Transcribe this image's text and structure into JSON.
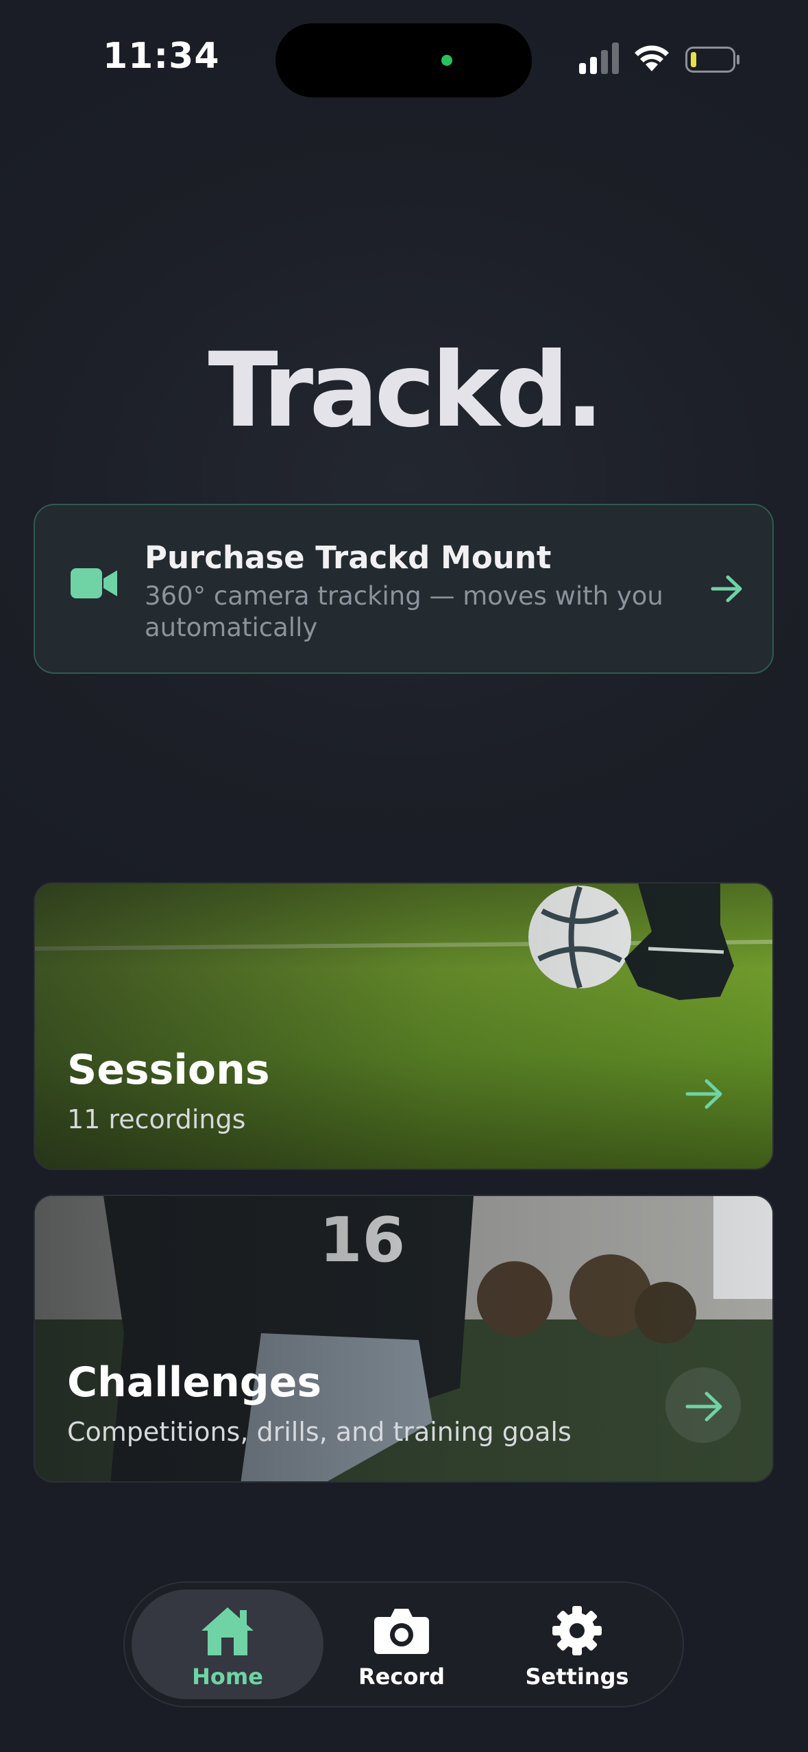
{
  "status_bar": {
    "time": "11:34"
  },
  "app": {
    "logo_text": "Trackd."
  },
  "purchase": {
    "title": "Purchase Trackd Mount",
    "subtitle": "360° camera tracking — moves with you automatically"
  },
  "cards": [
    {
      "title": "Sessions",
      "subtitle": "11 recordings"
    },
    {
      "title": "Challenges",
      "subtitle": "Competitions, drills, and training goals"
    }
  ],
  "nav": {
    "items": [
      {
        "label": "Home",
        "icon": "home-icon",
        "active": true
      },
      {
        "label": "Record",
        "icon": "camera-icon",
        "active": false
      },
      {
        "label": "Settings",
        "icon": "gear-icon",
        "active": false
      }
    ]
  },
  "colors": {
    "accent": "#6fd3a5",
    "background": "#1c1f27",
    "card_border": "#2f5b50"
  }
}
